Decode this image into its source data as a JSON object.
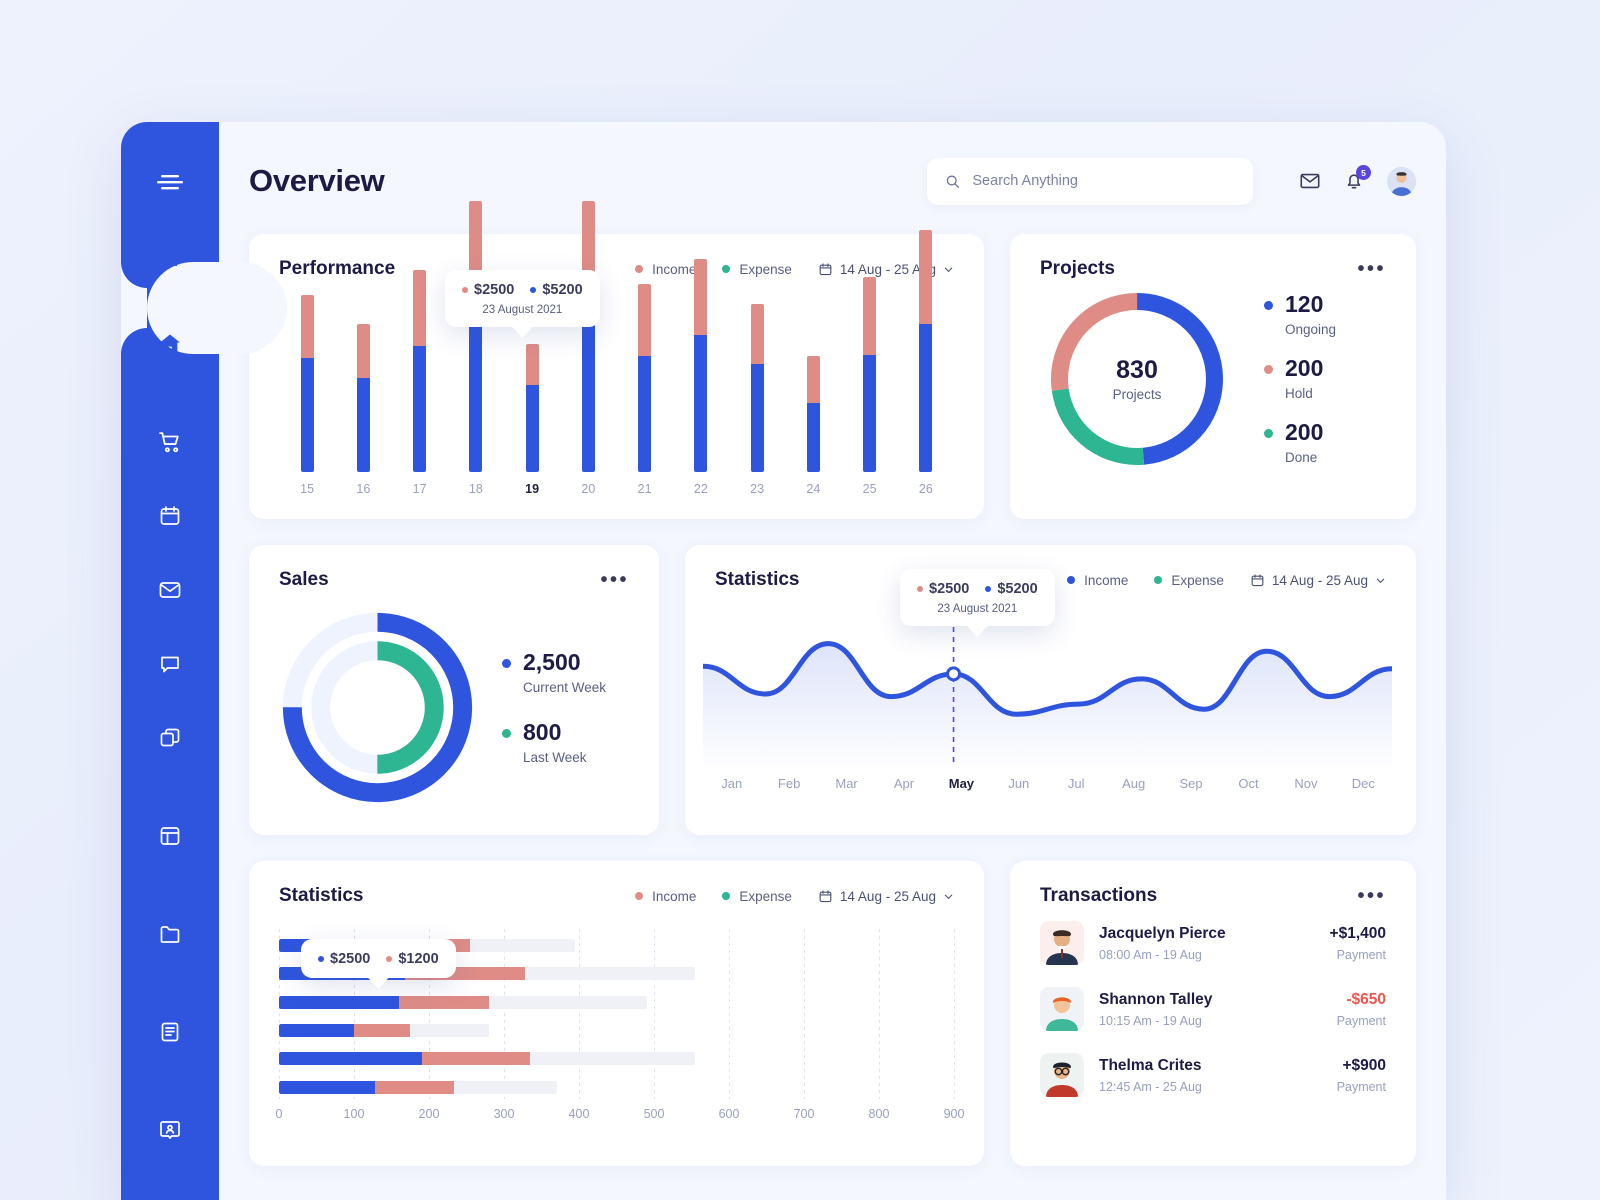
{
  "header": {
    "title": "Overview",
    "search_placeholder": "Search Anything",
    "search_value": "",
    "notification_count": "5"
  },
  "sidebar": {
    "items": [
      {
        "icon": "menu-icon",
        "name": "menu-toggle"
      },
      {
        "icon": "home-icon",
        "name": "sidebar-item-home",
        "active": true
      },
      {
        "icon": "cart-icon",
        "name": "sidebar-item-shop"
      },
      {
        "icon": "calendar-icon",
        "name": "sidebar-item-calendar"
      },
      {
        "icon": "mail-icon",
        "name": "sidebar-item-mail"
      },
      {
        "icon": "chat-icon",
        "name": "sidebar-item-chat"
      },
      {
        "icon": "layers-icon",
        "name": "sidebar-item-layers"
      },
      {
        "icon": "layout-icon",
        "name": "sidebar-item-layout"
      },
      {
        "icon": "folder-icon",
        "name": "sidebar-item-files"
      },
      {
        "icon": "document-icon",
        "name": "sidebar-item-reports"
      },
      {
        "icon": "user-card-icon",
        "name": "sidebar-item-contacts"
      }
    ]
  },
  "colors": {
    "brand_blue": "#2F55DE",
    "income_red": "#DF8C87",
    "expense_green": "#2EB592",
    "negative_red": "#F0544A",
    "track_gray": "#EFF1F6"
  },
  "performance": {
    "title": "Performance",
    "legend": [
      {
        "label": "Income",
        "color": "#DF8C87"
      },
      {
        "label": "Expense",
        "color": "#2EB592"
      }
    ],
    "date_range": "14 Aug - 25 Aug",
    "tooltip": {
      "income": "$2500",
      "expense": "$5200",
      "date": "23 August 2021"
    },
    "chart_data": {
      "type": "bar",
      "title": "Performance",
      "categories": [
        "15",
        "16",
        "17",
        "18",
        "19",
        "20",
        "21",
        "22",
        "23",
        "24",
        "25",
        "26"
      ],
      "selected_category": "19",
      "series": [
        {
          "name": "Expense",
          "color": "#2F55DE",
          "values": [
            63,
            52,
            70,
            85,
            48,
            85,
            64,
            76,
            60,
            38,
            65,
            82
          ]
        },
        {
          "name": "Income",
          "color": "#DF8C87",
          "values": [
            35,
            30,
            42,
            65,
            23,
            65,
            40,
            42,
            33,
            26,
            43,
            52
          ]
        }
      ],
      "stacked": true,
      "ylim": [
        0,
        160
      ],
      "grid": false,
      "xlabel": "",
      "ylabel": ""
    }
  },
  "projects": {
    "title": "Projects",
    "menu": "•••",
    "center_value": "830",
    "center_label": "Projects",
    "chart_data": {
      "type": "pie",
      "title": "Projects",
      "labels": [
        "Ongoing",
        "Hold",
        "Done"
      ],
      "values": [
        120,
        200,
        200
      ],
      "colors": [
        "#2F55DE",
        "#DF8C87",
        "#2EB592"
      ],
      "total": 830,
      "donut": true
    },
    "legend": [
      {
        "value": "120",
        "label": "Ongoing",
        "color": "#2F55DE"
      },
      {
        "value": "200",
        "label": "Hold",
        "color": "#DF8C87"
      },
      {
        "value": "200",
        "label": "Done",
        "color": "#2EB592"
      }
    ]
  },
  "sales": {
    "title": "Sales",
    "menu": "•••",
    "chart_data": {
      "type": "pie",
      "title": "Sales",
      "donut": true,
      "rings": [
        {
          "name": "Current Week",
          "value": 2500,
          "percent": 75,
          "color": "#2F55DE"
        },
        {
          "name": "Last Week",
          "value": 800,
          "percent": 50,
          "color": "#2EB592"
        }
      ]
    },
    "legend": [
      {
        "value": "2,500",
        "label": "Current Week",
        "color": "#2F55DE"
      },
      {
        "value": "800",
        "label": "Last Week",
        "color": "#2EB592"
      }
    ]
  },
  "statistics_line": {
    "title": "Statistics",
    "legend": [
      {
        "label": "Income",
        "color": "#2F55DE"
      },
      {
        "label": "Expense",
        "color": "#2EB592"
      }
    ],
    "date_range": "14 Aug - 25 Aug",
    "tooltip": {
      "income": "$2500",
      "expense": "$5200",
      "date": "23 August 2021"
    },
    "chart_data": {
      "type": "line",
      "title": "Statistics",
      "x": [
        "Jan",
        "Feb",
        "Mar",
        "Apr",
        "May",
        "Jun",
        "Jul",
        "Aug",
        "Sep",
        "Oct",
        "Nov",
        "Dec"
      ],
      "selected_x": "May",
      "series": [
        {
          "name": "Income",
          "color": "#2F55DE",
          "values": [
            68,
            46,
            86,
            44,
            62,
            30,
            38,
            58,
            34,
            80,
            44,
            66
          ]
        }
      ],
      "ylim": [
        0,
        100
      ],
      "grid": false,
      "xlabel": "",
      "ylabel": ""
    }
  },
  "statistics_bar": {
    "title": "Statistics",
    "legend": [
      {
        "label": "Income",
        "color": "#DF8C87"
      },
      {
        "label": "Expense",
        "color": "#2EB592"
      }
    ],
    "date_range": "14 Aug - 25 Aug",
    "tooltip": {
      "expense": "$2500",
      "income": "$1200",
      "expense_color": "#2F55DE",
      "income_color": "#DF8C87"
    },
    "chart_data": {
      "type": "bar",
      "title": "Statistics",
      "orientation": "horizontal",
      "axis_ticks": [
        "0",
        "100",
        "200",
        "300",
        "400",
        "500",
        "600",
        "700",
        "800",
        "900"
      ],
      "xlim": [
        0,
        900
      ],
      "grid": true,
      "series": [
        {
          "name": "Expense",
          "color": "#2F55DE",
          "values": [
            140,
            168,
            160,
            100,
            190,
            128
          ]
        },
        {
          "name": "Income",
          "color": "#DF8C87",
          "values": [
            115,
            160,
            120,
            75,
            145,
            105
          ]
        },
        {
          "name": "Total track",
          "color": "#EFF1F6",
          "values": [
            395,
            555,
            490,
            280,
            555,
            370
          ]
        }
      ]
    }
  },
  "transactions": {
    "title": "Transactions",
    "menu": "•••",
    "items": [
      {
        "name": "Jacquelyn  Pierce",
        "time": "08:00 Am - 19 Aug",
        "amount": "+$1,400",
        "kind": "Payment",
        "negative": false,
        "avatar": "avatar-man-suit"
      },
      {
        "name": "Shannon Talley",
        "time": "10:15 Am - 19 Aug",
        "amount": "-$650",
        "kind": "Payment",
        "negative": true,
        "avatar": "avatar-redhead"
      },
      {
        "name": "Thelma Crites",
        "time": "12:45 Am - 25 Aug",
        "amount": "+$900",
        "kind": "Payment",
        "negative": false,
        "avatar": "avatar-glasses"
      }
    ]
  }
}
